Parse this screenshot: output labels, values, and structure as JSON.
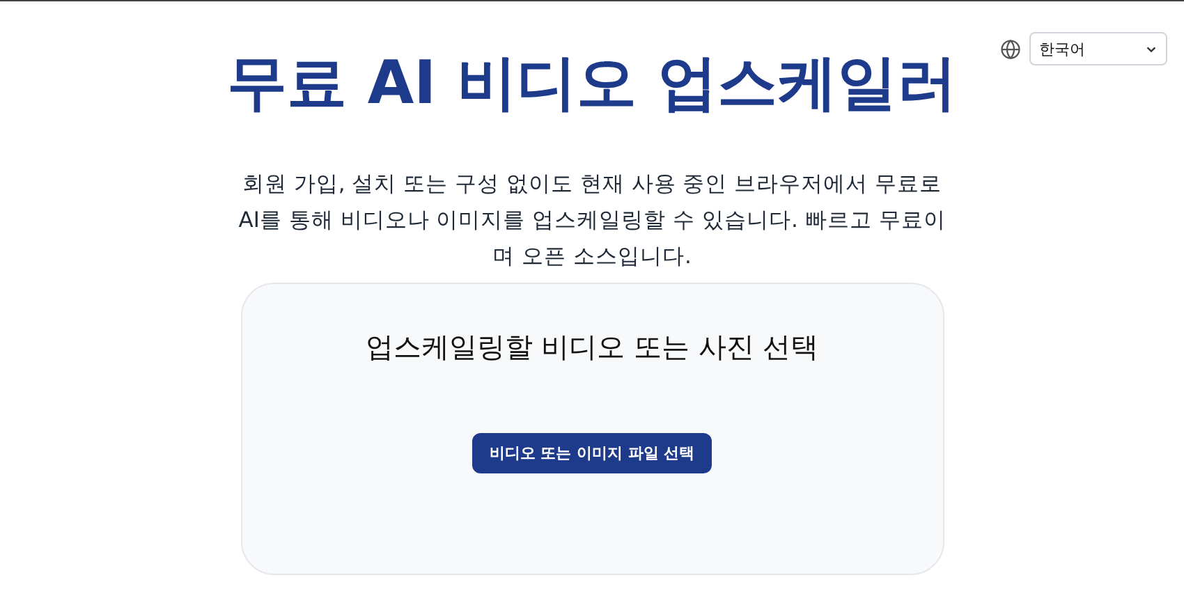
{
  "language_select": {
    "value": "한국어"
  },
  "title": "무료 AI 비디오 업스케일러",
  "description": "회원 가입, 설치 또는 구성 없이도 현재 사용 중인 브라우저에서 무료로 AI를 통해 비디오나 이미지를 업스케일링할 수 있습니다. 빠르고 무료이며 오픈 소스입니다.",
  "upload_card": {
    "heading": "업스케일링할 비디오 또는 사진 선택",
    "button": "비디오 또는 이미지 파일 선택"
  }
}
